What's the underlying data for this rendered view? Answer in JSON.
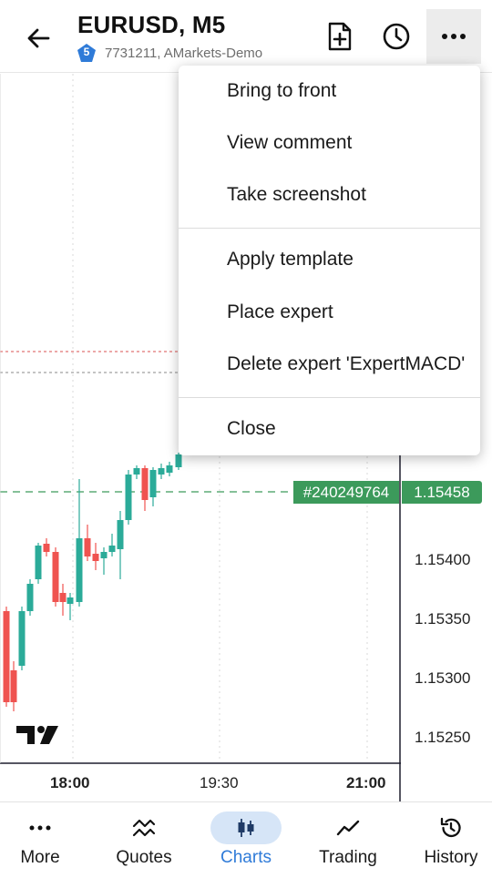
{
  "header": {
    "title": "EURUSD, M5",
    "badge_number": "5",
    "account": "7731211, AMarkets-Demo",
    "back_icon": "arrow-left-icon",
    "new_order_icon": "file-plus-icon",
    "history_icon": "clock-icon",
    "more_icon": "more-dots-icon"
  },
  "chart": {
    "price_labels": [
      "1.15400",
      "1.15350",
      "1.15300",
      "1.15250"
    ],
    "time_labels": [
      "18:00",
      "19:30",
      "21:00"
    ],
    "order_tag": "#240249764",
    "price_tag": "1.15458",
    "colors": {
      "up": "#2bab99",
      "down": "#ef5350",
      "order_line": "#3c9a5b",
      "accent": "#2f7bd8"
    }
  },
  "menu": {
    "items": [
      "Bring to front",
      "View comment",
      "Take screenshot",
      "Apply template",
      "Place expert",
      "Delete expert 'ExpertMACD'",
      "Close"
    ]
  },
  "nav": {
    "items": [
      {
        "label": "More",
        "icon": "dots-icon"
      },
      {
        "label": "Quotes",
        "icon": "quotes-icon"
      },
      {
        "label": "Charts",
        "icon": "candles-icon"
      },
      {
        "label": "Trading",
        "icon": "trend-icon"
      },
      {
        "label": "History",
        "icon": "history-icon"
      }
    ],
    "active": "Charts"
  }
}
